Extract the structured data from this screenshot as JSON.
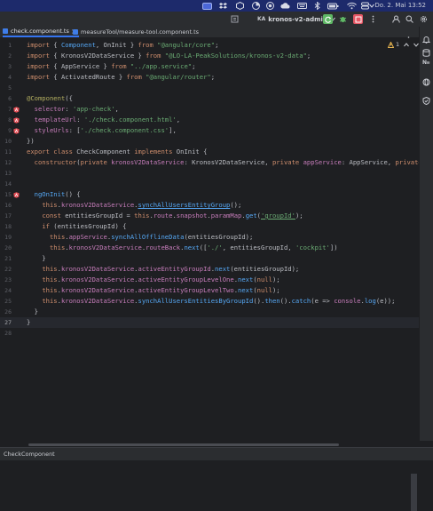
{
  "menubar": {
    "clock": "Do. 2. Mai  13:52"
  },
  "toolbar": {
    "project_badge": "KA",
    "project_name": "kronos-v2-admin"
  },
  "tabs": [
    {
      "label": "check.component.ts",
      "active": true
    },
    {
      "label": "measureTool/measure-tool.component.ts",
      "active": false
    }
  ],
  "warnings": {
    "count": "1"
  },
  "editor": {
    "line_numbers": [
      "1",
      "2",
      "3",
      "4",
      "5",
      "6",
      "7",
      "8",
      "9",
      "10",
      "11",
      "12",
      "13",
      "14",
      "15",
      "16",
      "17",
      "18",
      "19",
      "20",
      "21",
      "22",
      "23",
      "24",
      "25",
      "26",
      "27",
      "28"
    ],
    "current_line": 27,
    "gutter_icons": {
      "7": "angular",
      "8": "angular",
      "9": "angular",
      "15": "angular"
    },
    "lines": [
      [
        [
          "k",
          "import"
        ],
        [
          "v",
          " { "
        ],
        [
          "t",
          "Component"
        ],
        [
          "v",
          ", OnInit } "
        ],
        [
          "k",
          "from"
        ],
        [
          "v",
          " "
        ],
        [
          "s",
          "\"@angular/core\""
        ],
        [
          "v",
          ";"
        ]
      ],
      [
        [
          "k",
          "import"
        ],
        [
          "v",
          " { KronosV2DataService } "
        ],
        [
          "k",
          "from"
        ],
        [
          "v",
          " "
        ],
        [
          "s",
          "\"@LO-LA-PeakSolutions/kronos-v2-data\""
        ],
        [
          "v",
          ";"
        ]
      ],
      [
        [
          "k",
          "import"
        ],
        [
          "v",
          " { AppService } "
        ],
        [
          "k",
          "from"
        ],
        [
          "v",
          " "
        ],
        [
          "s",
          "\"../app.service\""
        ],
        [
          "v",
          ";"
        ]
      ],
      [
        [
          "k",
          "import"
        ],
        [
          "v",
          " { ActivatedRoute } "
        ],
        [
          "k",
          "from"
        ],
        [
          "v",
          " "
        ],
        [
          "s",
          "\"@angular/router\""
        ],
        [
          "v",
          ";"
        ]
      ],
      [],
      [
        [
          "d",
          "@Component"
        ],
        [
          "v",
          "({"
        ]
      ],
      [
        [
          "v",
          "  "
        ],
        [
          "p",
          "selector"
        ],
        [
          "v",
          ": "
        ],
        [
          "s",
          "'app-check'"
        ],
        [
          "v",
          ","
        ]
      ],
      [
        [
          "v",
          "  "
        ],
        [
          "p",
          "templateUrl"
        ],
        [
          "v",
          ": "
        ],
        [
          "s",
          "'./check.component.html'"
        ],
        [
          "v",
          ","
        ]
      ],
      [
        [
          "v",
          "  "
        ],
        [
          "p",
          "styleUrls"
        ],
        [
          "v",
          ": ["
        ],
        [
          "s",
          "'./check.component.css'"
        ],
        [
          "v",
          "],"
        ]
      ],
      [
        [
          "v",
          "})"
        ]
      ],
      [
        [
          "k",
          "export class"
        ],
        [
          "v",
          " CheckComponent "
        ],
        [
          "k",
          "implements"
        ],
        [
          "v",
          " OnInit {"
        ]
      ],
      [
        [
          "v",
          "  "
        ],
        [
          "k",
          "constructor"
        ],
        [
          "v",
          "("
        ],
        [
          "k",
          "private"
        ],
        [
          "v",
          " "
        ],
        [
          "p",
          "kronosV2DataService"
        ],
        [
          "v",
          ": KronosV2DataService, "
        ],
        [
          "k",
          "private"
        ],
        [
          "v",
          " "
        ],
        [
          "p",
          "appService"
        ],
        [
          "v",
          ": AppService, "
        ],
        [
          "k",
          "private"
        ],
        [
          "v",
          " r"
        ]
      ],
      [],
      [],
      [
        [
          "v",
          "  "
        ],
        [
          "f",
          "ngOnInit"
        ],
        [
          "v",
          "() {"
        ]
      ],
      [
        [
          "v",
          "    "
        ],
        [
          "k",
          "this"
        ],
        [
          "v",
          "."
        ],
        [
          "p",
          "kronosV2DataService"
        ],
        [
          "v",
          "."
        ],
        [
          "fu",
          "synchAllUsersEntityGroup"
        ],
        [
          "v",
          "();"
        ]
      ],
      [
        [
          "v",
          "    "
        ],
        [
          "k",
          "const"
        ],
        [
          "v",
          " entitiesGroupId = "
        ],
        [
          "k",
          "this"
        ],
        [
          "v",
          "."
        ],
        [
          "p",
          "route"
        ],
        [
          "v",
          "."
        ],
        [
          "p",
          "snapshot"
        ],
        [
          "v",
          "."
        ],
        [
          "p",
          "paramMap"
        ],
        [
          "v",
          "."
        ],
        [
          "f",
          "get"
        ],
        [
          "v",
          "("
        ],
        [
          "su",
          "'groupId'"
        ],
        [
          "v",
          ");"
        ]
      ],
      [
        [
          "v",
          "    "
        ],
        [
          "k",
          "if"
        ],
        [
          "v",
          " (entitiesGroupId) {"
        ]
      ],
      [
        [
          "v",
          "      "
        ],
        [
          "k",
          "this"
        ],
        [
          "v",
          "."
        ],
        [
          "p",
          "appService"
        ],
        [
          "v",
          "."
        ],
        [
          "f",
          "synchAllOfflineData"
        ],
        [
          "v",
          "(entitiesGroupId);"
        ]
      ],
      [
        [
          "v",
          "      "
        ],
        [
          "k",
          "this"
        ],
        [
          "v",
          "."
        ],
        [
          "p",
          "kronosV2DataService"
        ],
        [
          "v",
          "."
        ],
        [
          "p",
          "routeBack"
        ],
        [
          "v",
          "."
        ],
        [
          "f",
          "next"
        ],
        [
          "v",
          "(["
        ],
        [
          "s",
          "'./'"
        ],
        [
          "v",
          ", entitiesGroupId, "
        ],
        [
          "s",
          "'cockpit'"
        ],
        [
          "v",
          "])"
        ]
      ],
      [
        [
          "v",
          "    }"
        ]
      ],
      [
        [
          "v",
          "    "
        ],
        [
          "k",
          "this"
        ],
        [
          "v",
          "."
        ],
        [
          "p",
          "kronosV2DataService"
        ],
        [
          "v",
          "."
        ],
        [
          "p",
          "activeEntityGroupId"
        ],
        [
          "v",
          "."
        ],
        [
          "f",
          "next"
        ],
        [
          "v",
          "(entitiesGroupId);"
        ]
      ],
      [
        [
          "v",
          "    "
        ],
        [
          "k",
          "this"
        ],
        [
          "v",
          "."
        ],
        [
          "p",
          "kronosV2DataService"
        ],
        [
          "v",
          "."
        ],
        [
          "p",
          "activeEntityGroupLevelOne"
        ],
        [
          "v",
          "."
        ],
        [
          "f",
          "next"
        ],
        [
          "v",
          "("
        ],
        [
          "k",
          "null"
        ],
        [
          "v",
          ");"
        ]
      ],
      [
        [
          "v",
          "    "
        ],
        [
          "k",
          "this"
        ],
        [
          "v",
          "."
        ],
        [
          "p",
          "kronosV2DataService"
        ],
        [
          "v",
          "."
        ],
        [
          "p",
          "activeEntityGroupLevelTwo"
        ],
        [
          "v",
          "."
        ],
        [
          "f",
          "next"
        ],
        [
          "v",
          "("
        ],
        [
          "k",
          "null"
        ],
        [
          "v",
          ");"
        ]
      ],
      [
        [
          "v",
          "    "
        ],
        [
          "k",
          "this"
        ],
        [
          "v",
          "."
        ],
        [
          "p",
          "kronosV2DataService"
        ],
        [
          "v",
          "."
        ],
        [
          "f",
          "synchAllUsersEntitiesByGroupId"
        ],
        [
          "v",
          "()."
        ],
        [
          "f",
          "then"
        ],
        [
          "v",
          "()."
        ],
        [
          "f",
          "catch"
        ],
        [
          "v",
          "(e => "
        ],
        [
          "p",
          "console"
        ],
        [
          "v",
          "."
        ],
        [
          "f",
          "log"
        ],
        [
          "v",
          "(e));"
        ]
      ],
      [
        [
          "v",
          "  }"
        ]
      ],
      [
        [
          "v",
          "}"
        ]
      ],
      []
    ]
  },
  "bottom": {
    "breadcrumb": "CheckComponent"
  },
  "colors": {
    "menubar_bg": "#1d2a6b",
    "accent": "#3574f0",
    "run_green": "#5fb865",
    "stop_red": "#e55765",
    "angular_badge": "#e34f57"
  }
}
